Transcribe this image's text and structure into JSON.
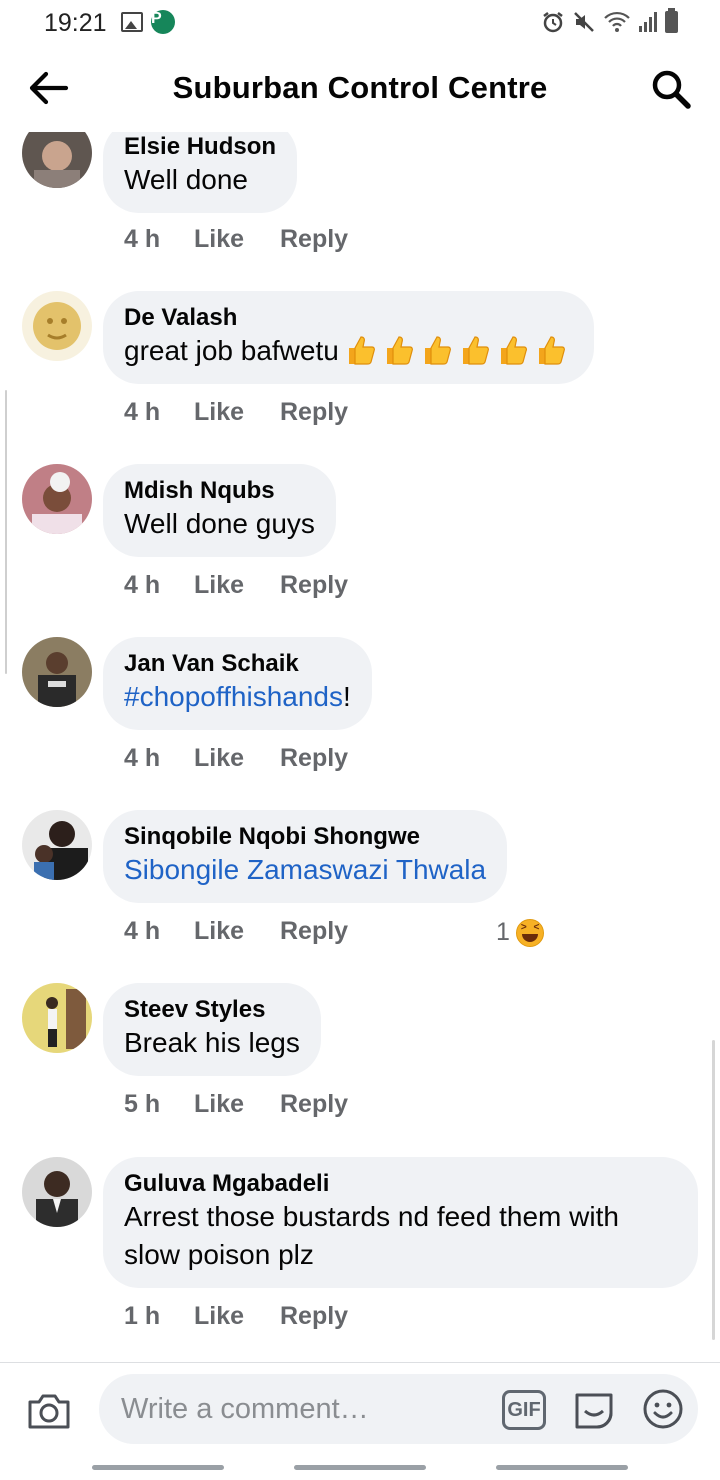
{
  "status_bar": {
    "time": "19:21",
    "app_badge": "P",
    "icons": [
      "gallery-icon",
      "app-badge-icon",
      "alarm-icon",
      "mute-icon",
      "wifi-icon",
      "signal-icon",
      "battery-icon"
    ]
  },
  "header": {
    "title": "Suburban Control Centre",
    "back_icon": "arrow-left-icon",
    "search_icon": "search-icon"
  },
  "comments": [
    {
      "author": "Elsie Hudson",
      "text": "Well done",
      "time": "4 h",
      "like_label": "Like",
      "reply_label": "Reply",
      "avatar_color": "#8a7c72"
    },
    {
      "author": "De  Valash",
      "text": "great job bafwetu",
      "emoji": "👍👍👍👍👍👍",
      "emoji_count": 6,
      "time": "4 h",
      "like_label": "Like",
      "reply_label": "Reply",
      "avatar_color": "#e9cf80"
    },
    {
      "author": "Mdish Nqubs",
      "text": "Well done guys",
      "time": "4 h",
      "like_label": "Like",
      "reply_label": "Reply",
      "avatar_color": "#b76a63"
    },
    {
      "author": "Jan Van Schaik",
      "link": "#chopoffhishands",
      "text_suffix": "!",
      "time": "4 h",
      "like_label": "Like",
      "reply_label": "Reply",
      "avatar_color": "#5c5f57"
    },
    {
      "author": "Sinqobile Nqobi Shongwe",
      "link": "Sibongile Zamaswazi Thwala",
      "time": "4 h",
      "like_label": "Like",
      "reply_label": "Reply",
      "reaction_count": "1",
      "reaction_icon": "haha-icon",
      "avatar_color": "#3b2e2a"
    },
    {
      "author": "Steev Styles",
      "text": "Break his legs",
      "time": "5 h",
      "like_label": "Like",
      "reply_label": "Reply",
      "avatar_color": "#c9b660"
    },
    {
      "author": "Guluva Mgabadeli",
      "text": "Arrest those bustards nd feed them with slow poison plz",
      "time": "1 h",
      "like_label": "Like",
      "reply_label": "Reply",
      "avatar_color": "#6d6d6d"
    }
  ],
  "composer": {
    "placeholder": "Write a comment…",
    "gif_label": "GIF",
    "camera_icon": "camera-icon",
    "sticker_icon": "sticker-icon",
    "emoji_icon": "emoji-icon"
  },
  "colors": {
    "bubble": "#f0f2f5",
    "link": "#1f63c6",
    "meta_text": "#65676b"
  }
}
